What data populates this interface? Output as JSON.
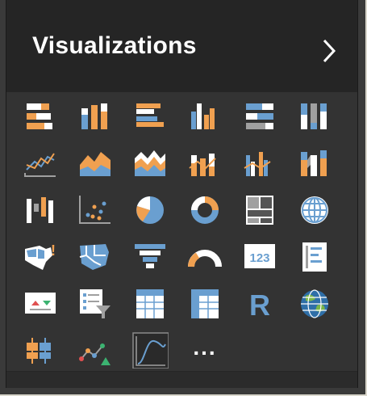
{
  "header": {
    "title": "Visualizations"
  },
  "icons": [
    "stacked-bar-chart-icon",
    "stacked-column-chart-icon",
    "clustered-bar-chart-icon",
    "clustered-column-chart-icon",
    "100-stacked-bar-chart-icon",
    "100-stacked-column-chart-icon",
    "line-chart-icon",
    "area-chart-icon",
    "stacked-area-chart-icon",
    "line-and-stacked-column-chart-icon",
    "line-and-clustered-column-chart-icon",
    "ribbon-chart-icon",
    "waterfall-chart-icon",
    "scatter-chart-icon",
    "pie-chart-icon",
    "donut-chart-icon",
    "treemap-icon",
    "map-icon",
    "filled-map-icon",
    "shape-map-icon",
    "funnel-icon",
    "gauge-icon",
    "card-icon",
    "multi-row-card-icon",
    "kpi-icon",
    "slicer-icon",
    "table-icon",
    "matrix-icon",
    "r-script-visual-icon",
    "arcgis-map-icon",
    "custom-visual-icon",
    "line-dot-chart-icon",
    "custom-line-visual-icon",
    "more-options-icon"
  ],
  "more_label": "...",
  "colors": {
    "orange": "#f0a050",
    "blue": "#6a9fd0",
    "grey": "#a0a0a0",
    "white": "#ffffff"
  }
}
